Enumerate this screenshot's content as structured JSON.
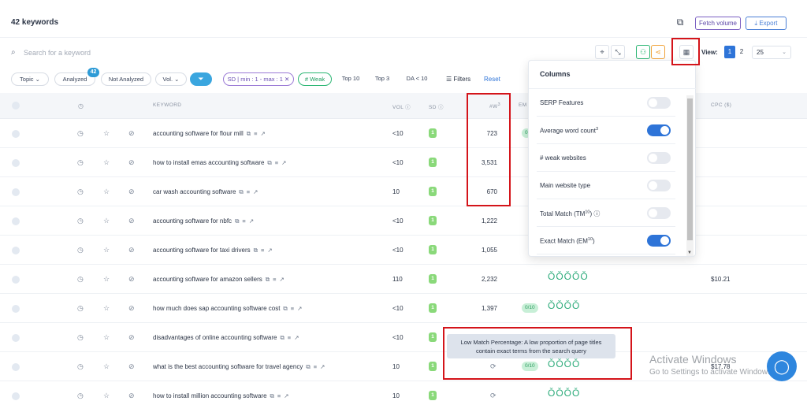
{
  "header": {
    "keyword_count": "42 keywords",
    "fetch_volume": "Fetch volume",
    "export": "Export",
    "export_icon": "download-icon",
    "tool_icon": "apps-icon"
  },
  "search": {
    "placeholder": "Search for a keyword",
    "icon": "search-icon"
  },
  "view": {
    "label": "View:",
    "pages": [
      "1",
      "2"
    ],
    "active_page": "1",
    "per_page": "25"
  },
  "filters": {
    "topic": "Topic",
    "analyzed": "Analyzed",
    "analyzed_badge": "42",
    "not_analyzed": "Not Analyzed",
    "vol": "Vol.",
    "sd_range": "SD | min : 1 - max : 1",
    "weak": "# Weak",
    "top10": "Top 10",
    "top3": "Top 3",
    "da": "DA < 10",
    "filters_label": "Filters",
    "reset_label": "Reset"
  },
  "table": {
    "headers": {
      "keyword": "KEYWORD",
      "vol": "VOL",
      "sd": "SD",
      "weak": "#W",
      "weak_sup": "3",
      "em": "EM",
      "cpc": "CPC ($)"
    },
    "rows": [
      {
        "keyword": "accounting software for flour mill",
        "vol": "<10",
        "sd": "1",
        "weak": "723",
        "em": "0",
        "rings": "",
        "cpc": ""
      },
      {
        "keyword": "how to install emas accounting software",
        "vol": "<10",
        "sd": "1",
        "weak": "3,531",
        "em": "",
        "rings": "",
        "cpc": ""
      },
      {
        "keyword": "car wash accounting software",
        "vol": "10",
        "sd": "1",
        "weak": "670",
        "em": "",
        "rings": "",
        "cpc": ""
      },
      {
        "keyword": "accounting software for nbfc",
        "vol": "<10",
        "sd": "1",
        "weak": "1,222",
        "em": "",
        "rings": "",
        "cpc": ""
      },
      {
        "keyword": "accounting software for taxi drivers",
        "vol": "<10",
        "sd": "1",
        "weak": "1,055",
        "em": "",
        "rings": "",
        "cpc": ""
      },
      {
        "keyword": "accounting software for amazon sellers",
        "vol": "110",
        "sd": "1",
        "weak": "2,232",
        "em": "",
        "rings": "ǑǑǑǑǑ",
        "cpc": "$10.21"
      },
      {
        "keyword": "how much does sap accounting software cost",
        "vol": "<10",
        "sd": "1",
        "weak": "1,397",
        "em": "0/10",
        "rings": "ǑǑǑǑ",
        "cpc": ""
      },
      {
        "keyword": "disadvantages of online accounting software",
        "vol": "<10",
        "sd": "1",
        "weak": "",
        "em": "",
        "rings": "",
        "cpc": ""
      },
      {
        "keyword": "what is the best accounting software for travel agency",
        "vol": "10",
        "sd": "1",
        "weak": "",
        "em": "0/10",
        "rings": "ǑǑǑǑ",
        "cpc": "$17.78"
      },
      {
        "keyword": "how to install million accounting software",
        "vol": "10",
        "sd": "1",
        "weak": "",
        "em": "",
        "rings": "ǑǑǑǑ",
        "cpc": ""
      }
    ]
  },
  "columns_panel": {
    "title": "Columns",
    "options": [
      {
        "label": "SERP Features",
        "on": false
      },
      {
        "label": "Average word count",
        "sup": "3",
        "on": true
      },
      {
        "label": "# weak websites",
        "on": false
      },
      {
        "label": "Main website type",
        "on": false
      },
      {
        "label": "Total Match (TM",
        "sup": "10",
        "suffix": ")",
        "on": false
      },
      {
        "label": "Exact Match (EM",
        "sup": "10",
        "suffix": ")",
        "on": true
      }
    ]
  },
  "tooltip": {
    "line1": "Low Match Percentage: A low proportion of page titles",
    "line2": "contain exact terms from the search query"
  },
  "windows_watermark": {
    "title": "Activate Windows",
    "subtitle": "Go to Settings to activate Windows."
  },
  "colors": {
    "accent": "#2e74d8",
    "highlight": "#d4141a",
    "weak_chip": "#2bb673"
  }
}
